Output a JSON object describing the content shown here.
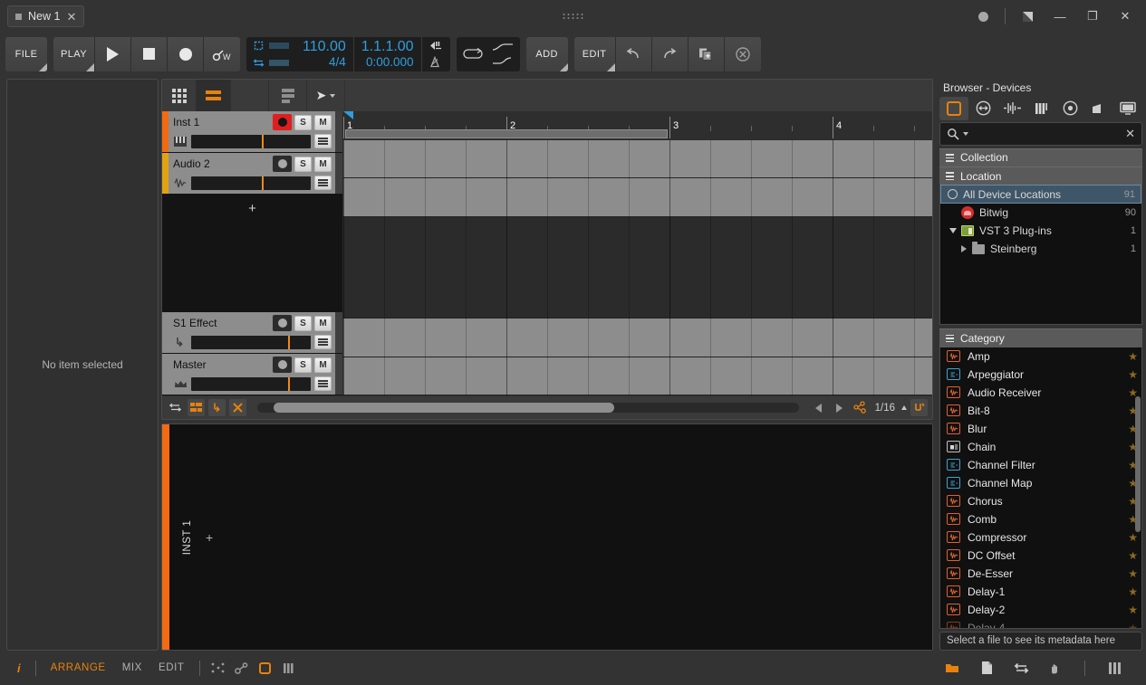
{
  "window": {
    "tab_label": "New 1",
    "close_label": "✕",
    "controls": {
      "minimize": "—",
      "maximize": "❐",
      "close": "✕"
    }
  },
  "transport": {
    "file_label": "FILE",
    "play_mode_label": "PLAY",
    "play_label": "▶",
    "stop_label": "■",
    "record_label": "●",
    "automation_label": "W",
    "tempo": "110.00",
    "signature": "4/4",
    "position_bars": "1.1.1.00",
    "position_time": "0:00.000",
    "add_label": "ADD",
    "edit_label": "EDIT",
    "undo_label": "↶",
    "redo_label": "↷",
    "duplicate_label": "⧉",
    "clear_label": "⊗"
  },
  "inspector": {
    "empty_text": "No item selected"
  },
  "arranger": {
    "ruler": {
      "bars": [
        "1",
        "2",
        "3",
        "4"
      ],
      "loop_start_bar": 1,
      "loop_end_bar": 3
    },
    "tracks": [
      {
        "name": "Inst 1",
        "color": "#f26a12",
        "record_armed": true,
        "solo": "S",
        "mute": "M",
        "type_icon": "keyboard-icon",
        "fader_pct": 60
      },
      {
        "name": "Audio 2",
        "color": "#e0a412",
        "record_armed": false,
        "solo": "S",
        "mute": "M",
        "type_icon": "waveform-icon",
        "fader_pct": 60
      },
      {
        "name": "S1 Effect",
        "color": "#8d8d8d",
        "record_armed": false,
        "solo": "S",
        "mute": "M",
        "type_icon": "arrow-down-icon",
        "fader_pct": 82
      },
      {
        "name": "Master",
        "color": "#8d8d8d",
        "record_armed": false,
        "solo": "S",
        "mute": "M",
        "type_icon": "crown-icon",
        "fader_pct": 82
      }
    ],
    "add_track_label": "+",
    "footer": {
      "grid_value": "1/16"
    }
  },
  "editor": {
    "clip_label": "INST 1",
    "add_label": "+"
  },
  "browser": {
    "title": "Browser - Devices",
    "tabs": [
      {
        "name": "devices-tab",
        "icon": "square-outline-icon",
        "selected": true
      },
      {
        "name": "presets-tab",
        "icon": "circle-arrows-icon",
        "selected": false
      },
      {
        "name": "samples-tab",
        "icon": "waveform-icon",
        "selected": false
      },
      {
        "name": "multisamples-tab",
        "icon": "piano-keys-icon",
        "selected": false
      },
      {
        "name": "music-tab",
        "icon": "disc-icon",
        "selected": false
      },
      {
        "name": "clips-tab",
        "icon": "clip-shape-icon",
        "selected": false
      },
      {
        "name": "files-tab",
        "icon": "monitor-icon",
        "selected": false
      }
    ],
    "search_placeholder": "",
    "search_value": "",
    "clear_label": "✕",
    "sections": {
      "collection": "Collection",
      "location": "Location",
      "category": "Category"
    },
    "locations": [
      {
        "label": "All Device Locations",
        "count": "91",
        "indent": 0,
        "selected": true,
        "icon": "radio-circle-icon",
        "expander": ""
      },
      {
        "label": "Bitwig",
        "count": "90",
        "indent": 1,
        "selected": false,
        "icon": "bitwig-logo-icon",
        "expander": ""
      },
      {
        "label": "VST 3 Plug-ins",
        "count": "1",
        "indent": 1,
        "selected": false,
        "icon": "vst-plugin-icon",
        "expander": "down"
      },
      {
        "label": "Steinberg",
        "count": "1",
        "indent": 2,
        "selected": false,
        "icon": "folder-icon",
        "expander": "right"
      }
    ],
    "categories": [
      {
        "label": "Amp",
        "kind": "fx"
      },
      {
        "label": "Arpeggiator",
        "kind": "note"
      },
      {
        "label": "Audio Receiver",
        "kind": "fx"
      },
      {
        "label": "Bit-8",
        "kind": "fx"
      },
      {
        "label": "Blur",
        "kind": "fx"
      },
      {
        "label": "Chain",
        "kind": "container"
      },
      {
        "label": "Channel Filter",
        "kind": "note"
      },
      {
        "label": "Channel Map",
        "kind": "note"
      },
      {
        "label": "Chorus",
        "kind": "fx"
      },
      {
        "label": "Comb",
        "kind": "fx"
      },
      {
        "label": "Compressor",
        "kind": "fx"
      },
      {
        "label": "DC Offset",
        "kind": "fx"
      },
      {
        "label": "De-Esser",
        "kind": "fx"
      },
      {
        "label": "Delay-1",
        "kind": "fx"
      },
      {
        "label": "Delay-2",
        "kind": "fx"
      },
      {
        "label": "Delay-4",
        "kind": "fx"
      }
    ],
    "star_label": "★",
    "metadata_hint": "Select a file to see its metadata here"
  },
  "statusbar": {
    "info_label": "i",
    "views": [
      {
        "label": "ARRANGE",
        "active": true
      },
      {
        "label": "MIX",
        "active": false
      },
      {
        "label": "EDIT",
        "active": false
      }
    ],
    "left_icons": [
      "dots-pattern-icon",
      "chain-link-icon",
      "square-outline-icon",
      "mixer-bars-icon"
    ],
    "right_icons": [
      "folder-icon",
      "file-icon",
      "io-arrows-icon",
      "touch-hand-icon",
      "piano-keys-icon"
    ]
  },
  "colors": {
    "accent": "#e8820c",
    "display_blue": "#2e9fe0",
    "record_red": "#e01e1e",
    "track_inst": "#f26a12",
    "track_audio": "#e0a412"
  }
}
